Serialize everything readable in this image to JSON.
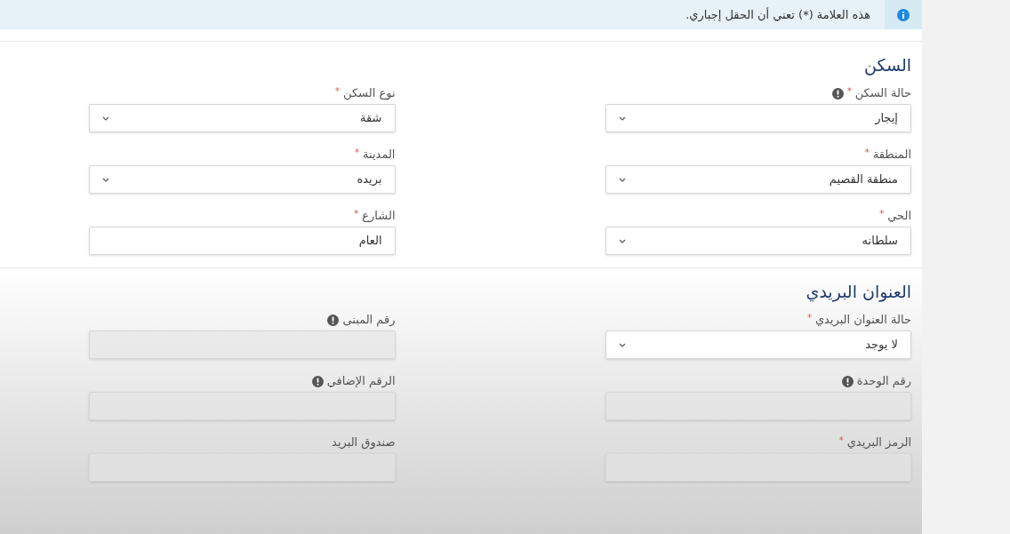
{
  "notice": {
    "text": "هذه العلامة (*) تعني أن الحقل إجباري."
  },
  "sections": [
    {
      "title": "السكن",
      "fields": [
        {
          "label": "حالة السكن",
          "required_mark": "*",
          "info": true,
          "kind": "select",
          "value": "إيجار",
          "disabled": false
        },
        {
          "label": "نوع السكن",
          "required_mark": "*",
          "info": false,
          "kind": "select",
          "value": "شقة",
          "disabled": false
        },
        {
          "label": "المنطقة",
          "required_mark": "*",
          "info": false,
          "kind": "select",
          "value": "منطقة القصيم",
          "disabled": false
        },
        {
          "label": "المدينة",
          "required_mark": "*",
          "info": false,
          "kind": "select",
          "value": "بريده",
          "disabled": false
        },
        {
          "label": "الحي",
          "required_mark": "*",
          "info": false,
          "kind": "select",
          "value": "سلطانه",
          "disabled": false
        },
        {
          "label": "الشارع",
          "required_mark": "*",
          "info": false,
          "kind": "text",
          "value": "العام",
          "disabled": false
        }
      ]
    },
    {
      "title": "العنوان البريدي",
      "fields": [
        {
          "label": "حالة العنوان البريدي",
          "required_mark": "*",
          "info": false,
          "kind": "select",
          "value": "لا يوجد",
          "disabled": false
        },
        {
          "label": "رقم المبنى",
          "info": true,
          "kind": "text",
          "disabled": true
        },
        {
          "label": "رقم الوحدة",
          "info": true,
          "kind": "text",
          "disabled": true
        },
        {
          "label": "الرقم الإضافي",
          "info": true,
          "kind": "text",
          "disabled": true
        },
        {
          "label": "الرمز البريدي",
          "required_mark": "*",
          "info": false,
          "kind": "text",
          "disabled": true
        },
        {
          "label": "صندوق البريد",
          "info": false,
          "kind": "text",
          "disabled": true
        }
      ]
    }
  ]
}
